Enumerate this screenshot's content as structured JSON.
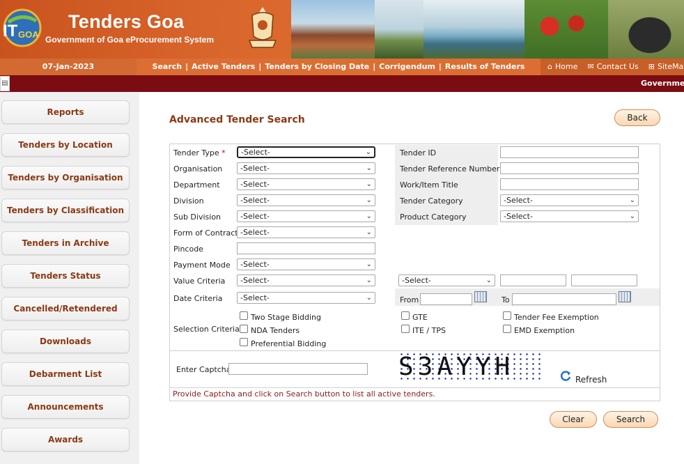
{
  "header": {
    "title": "Tenders Goa",
    "subtitle": "Government of Goa eProcurement System",
    "logo_text": "IT GOA"
  },
  "nav": {
    "date": "07-Jan-2023",
    "links": [
      "Search",
      "Active Tenders",
      "Tenders by Closing Date",
      "Corrigendum",
      "Results of Tenders"
    ],
    "separator": "|",
    "top_links": [
      {
        "icon": "home-icon",
        "label": "Home"
      },
      {
        "icon": "mail-icon",
        "label": "Contact Us"
      },
      {
        "icon": "sitemap-icon",
        "label": "SiteMap"
      }
    ]
  },
  "marquee": {
    "text": "Government"
  },
  "sidebar": {
    "items": [
      "Reports",
      "Tenders by Location",
      "Tenders by Organisation",
      "Tenders by Classification",
      "Tenders in Archive",
      "Tenders Status",
      "Cancelled/Retendered",
      "Downloads",
      "Debarment List",
      "Announcements",
      "Awards"
    ]
  },
  "main": {
    "title": "Advanced Tender Search",
    "back_label": "Back",
    "clear_label": "Clear",
    "search_label": "Search"
  },
  "form": {
    "select_default": "-Select-",
    "required_mark": "*",
    "left": {
      "tender_type": "Tender Type",
      "organisation": "Organisation",
      "department": "Department",
      "division": "Division",
      "sub_division": "Sub Division",
      "form_of_contract": "Form of Contract",
      "pincode": "Pincode",
      "payment_mode": "Payment Mode",
      "value_criteria": "Value Criteria",
      "date_criteria": "Date Criteria",
      "selection_criteria": "Selection Criteria"
    },
    "right": {
      "tender_id": "Tender ID",
      "tender_ref": "Tender Reference Number",
      "work_title": "Work/Item Title",
      "tender_category": "Tender Category",
      "product_category": "Product Category"
    },
    "date_from": "From",
    "date_to": "To",
    "checkboxes": {
      "two_stage": "Two Stage Bidding",
      "nda": "NDA Tenders",
      "preferential": "Preferential Bidding",
      "gte": "GTE",
      "ite_tps": "ITE / TPS",
      "fee_exemption": "Tender Fee Exemption",
      "emd_exemption": "EMD Exemption"
    },
    "captcha_label": "Enter Captcha",
    "captcha_text": "S3AYYH",
    "refresh_label": "Refresh",
    "message": "Provide Captcha and click on Search button to list all active tenders."
  }
}
